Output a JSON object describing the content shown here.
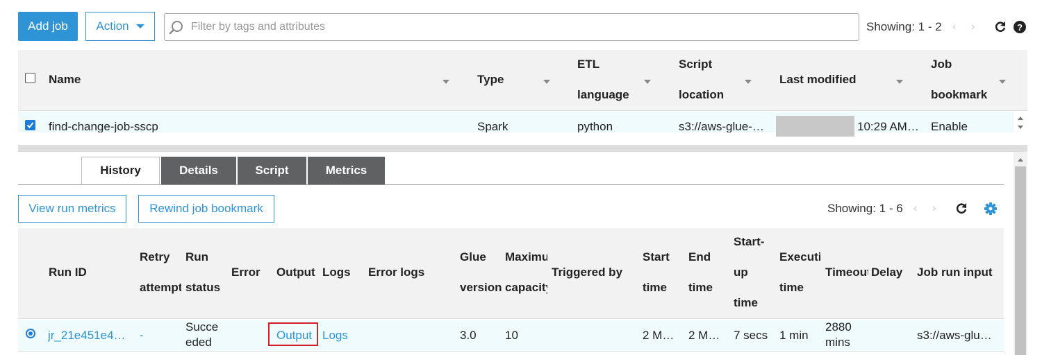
{
  "toolbar": {
    "add_job": "Add job",
    "action": "Action",
    "search_placeholder": "Filter by tags and attributes",
    "showing": "Showing: 1 - 2"
  },
  "jobs_table": {
    "headers": {
      "name": "Name",
      "type": "Type",
      "etl_line1": "ETL",
      "etl_line2": "language",
      "script_line1": "Script",
      "script_line2": "location",
      "last_modified": "Last modified",
      "bookmark_line1": "Job",
      "bookmark_line2": "bookmark"
    },
    "rows": [
      {
        "name": "find-change-job-sscp",
        "type": "Spark",
        "etl_language": "python",
        "script_location": "s3://aws-glue-…",
        "last_modified": "10:29 AM…",
        "job_bookmark": "Enable"
      }
    ]
  },
  "tabs": [
    "History",
    "Details",
    "Script",
    "Metrics"
  ],
  "history": {
    "view_run_metrics": "View run metrics",
    "rewind_bookmark": "Rewind job bookmark",
    "showing": "Showing: 1 - 6",
    "headers": {
      "run_id": "Run ID",
      "retry_1": "Retry",
      "retry_2": "attempt",
      "run_status_1": "Run",
      "run_status_2": "status",
      "error": "Error",
      "output": "Output",
      "logs": "Logs",
      "error_logs": "Error logs",
      "glue_1": "Glue",
      "glue_2": "version",
      "max_1": "Maximum",
      "max_2": "capacity",
      "triggered_by": "Triggered by",
      "start_1": "Start",
      "start_2": "time",
      "end_1": "End",
      "end_2": "time",
      "startup_1": "Start-",
      "startup_2": "up",
      "startup_3": "time",
      "exec_1": "Execution",
      "exec_2": "time",
      "timeout": "Timeout",
      "delay": "Delay",
      "job_run_input": "Job run input"
    },
    "rows": [
      {
        "run_id": "jr_21e451e4…",
        "retry": "-",
        "status_1": "Succe",
        "status_2": "eded",
        "output": "Output",
        "logs": "Logs",
        "glue_version": "3.0",
        "max_capacity": "10",
        "start_time": "2 M…",
        "end_time": "2 M…",
        "startup_time": "7 secs",
        "exec_time": "1 min",
        "timeout_1": "2880",
        "timeout_2": "mins",
        "job_run_input": "s3://aws-glu…"
      }
    ]
  },
  "colors": {
    "accent": "#2e94d6",
    "tab_inactive": "#5f6163",
    "row_selected": "#f0fbfd",
    "highlight": "#d41f26"
  }
}
